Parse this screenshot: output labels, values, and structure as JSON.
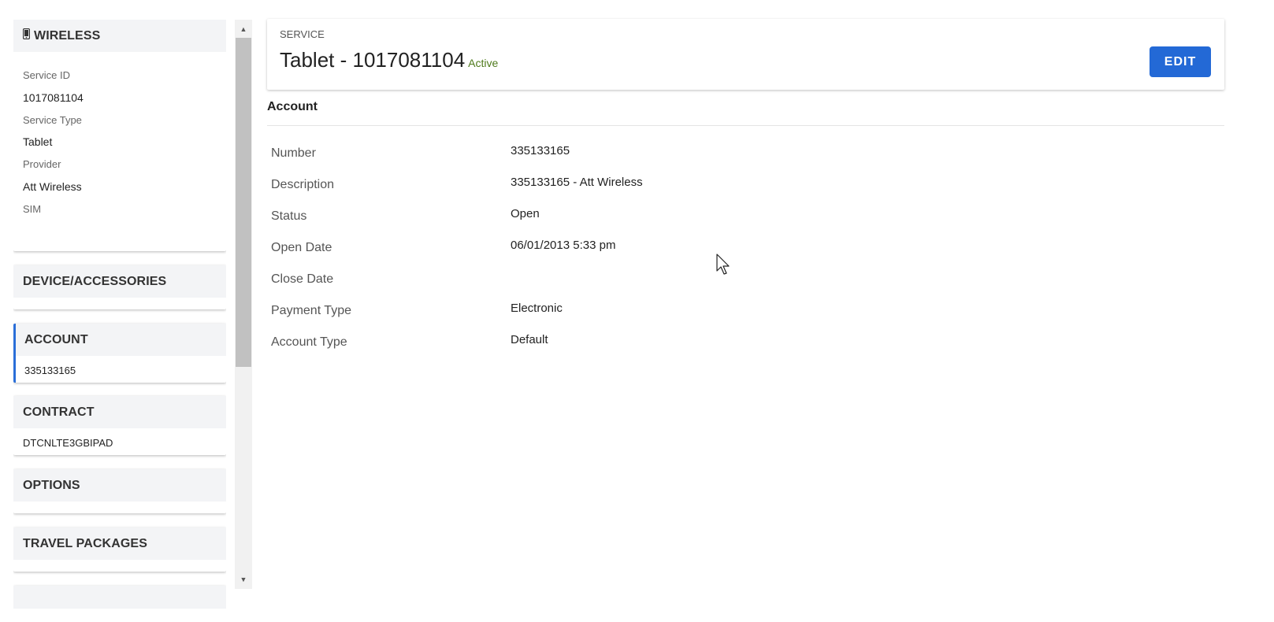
{
  "sidebar": {
    "wireless": {
      "title": "WIRELESS",
      "icon": "mobile-phone-icon",
      "fields": [
        {
          "label": "Service ID",
          "value": "1017081104"
        },
        {
          "label": "Service Type",
          "value": "Tablet"
        },
        {
          "label": "Provider",
          "value": "Att Wireless"
        },
        {
          "label": "SIM",
          "value": ""
        }
      ]
    },
    "device": {
      "title": "DEVICE/ACCESSORIES",
      "value": ""
    },
    "account": {
      "title": "ACCOUNT",
      "value": "335133165"
    },
    "contract": {
      "title": "CONTRACT",
      "value": "DTCNLTE3GBIPAD"
    },
    "options": {
      "title": "OPTIONS",
      "value": ""
    },
    "travel": {
      "title": "TRAVEL PACKAGES",
      "value": ""
    }
  },
  "header": {
    "label": "SERVICE",
    "title": "Tablet - 1017081104",
    "status": "Active",
    "edit_label": "EDIT"
  },
  "account_section": {
    "title": "Account",
    "rows": [
      {
        "label": "Number",
        "value": "335133165"
      },
      {
        "label": "Description",
        "value": "335133165 - Att Wireless"
      },
      {
        "label": "Status",
        "value": "Open"
      },
      {
        "label": "Open Date",
        "value": "06/01/2013 5:33 pm"
      },
      {
        "label": "Close Date",
        "value": ""
      },
      {
        "label": "Payment Type",
        "value": "Electronic"
      },
      {
        "label": "Account Type",
        "value": "Default"
      }
    ]
  },
  "colors": {
    "accent": "#2369d6",
    "active_status": "#4f7a1c",
    "active_card_border": "#2a6ed8"
  }
}
